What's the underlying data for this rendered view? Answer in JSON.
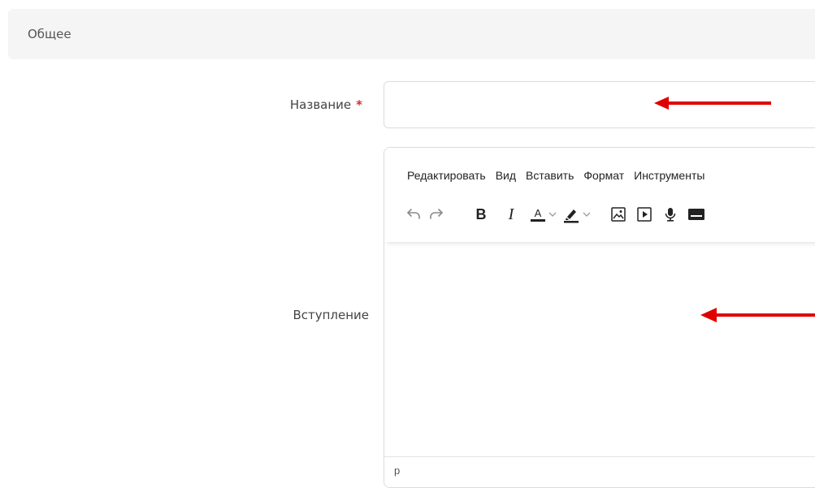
{
  "section": {
    "title": "Общее"
  },
  "form": {
    "name_label": "Название",
    "required_mark": "*",
    "name_value": "",
    "intro_label": "Вступление"
  },
  "editor": {
    "menu": [
      "Редактировать",
      "Вид",
      "Вставить",
      "Формат",
      "Инструменты"
    ],
    "toolbar": {
      "bold": "B",
      "italic": "I",
      "text_color": "A",
      "icons": [
        "undo-icon",
        "redo-icon",
        "bold-icon",
        "italic-icon",
        "text-color-icon",
        "chevron-down-icon",
        "highlight-icon",
        "chevron-down-icon",
        "image-icon",
        "media-icon",
        "microphone-icon",
        "card-icon"
      ]
    },
    "content": "",
    "status_path": "p"
  },
  "colors": {
    "annotation_arrow": "#e00000",
    "required": "#d32f2f",
    "header_bg": "#f5f5f5"
  }
}
